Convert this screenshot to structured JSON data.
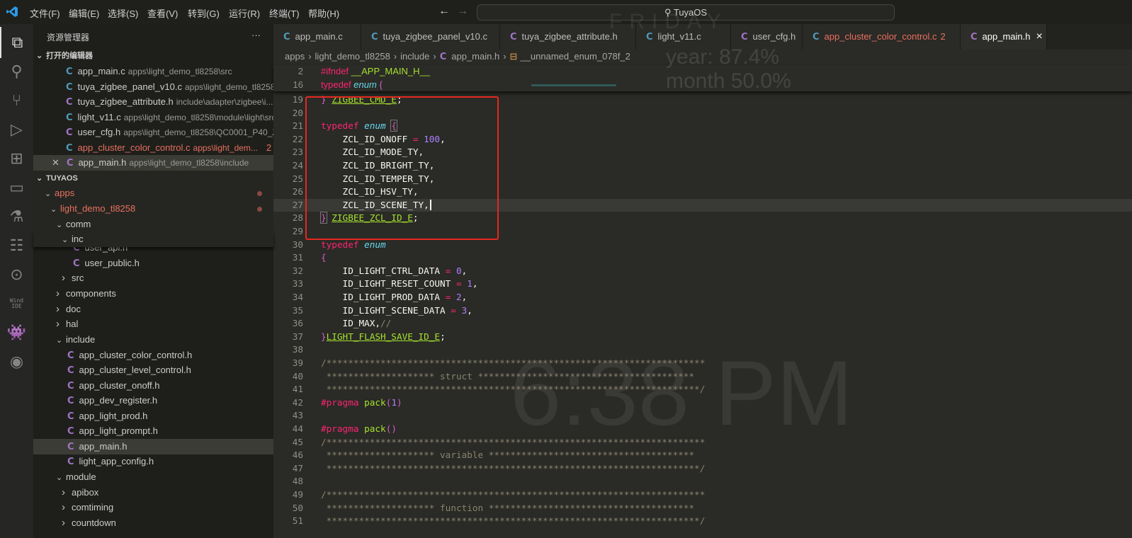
{
  "titlebar": {
    "menus": [
      "文件(F)",
      "编辑(E)",
      "选择(S)",
      "查看(V)",
      "转到(G)",
      "运行(R)",
      "终端(T)",
      "帮助(H)"
    ],
    "search": "TuyaOS",
    "back_icon": "arrow-left-icon",
    "forward_icon": "arrow-right-icon"
  },
  "activity_bar": [
    "explorer-icon",
    "search-icon",
    "source-control-icon",
    "run-debug-icon",
    "extensions-icon",
    "remote-explorer-icon",
    "testing-icon",
    "timeline-icon",
    "git-graph-icon",
    "wind-ide-icon",
    "platformio-icon",
    "espressif-icon"
  ],
  "wind_ide_label": "Wind IDE",
  "sidebar": {
    "title": "资源管理器",
    "more": "···",
    "open_editors_title": "打开的编辑器",
    "open_editors": [
      {
        "name": "app_main.c",
        "type": "c",
        "desc": "apps\\light_demo_tl8258\\src"
      },
      {
        "name": "tuya_zigbee_panel_v10.c",
        "type": "c",
        "desc": "apps\\light_demo_tl8258..."
      },
      {
        "name": "tuya_zigbee_attribute.h",
        "type": "h",
        "desc": "include\\adapter\\zigbee\\i..."
      },
      {
        "name": "light_v11.c",
        "type": "c",
        "desc": "apps\\light_demo_tl8258\\module\\light\\src"
      },
      {
        "name": "user_cfg.h",
        "type": "h",
        "desc": "apps\\light_demo_tl8258\\QC0001_P40_Z..."
      },
      {
        "name": "app_cluster_color_control.c",
        "type": "c",
        "desc": "apps\\light_dem...",
        "badge": "2",
        "error": true
      },
      {
        "name": "app_main.h",
        "type": "h",
        "desc": "apps\\light_demo_tl8258\\include",
        "active": true
      }
    ],
    "workspace_title": "TUYAOS",
    "tree": [
      {
        "label": "apps",
        "kind": "folder",
        "open": true,
        "depth": 0,
        "error": true
      },
      {
        "label": "light_demo_tl8258",
        "kind": "folder",
        "open": true,
        "depth": 1,
        "error": true
      },
      {
        "label": "comm",
        "kind": "folder",
        "open": true,
        "depth": 2
      },
      {
        "label": "inc",
        "kind": "folder",
        "open": true,
        "depth": 3
      },
      {
        "label": "user_api.h",
        "kind": "h",
        "depth": 4
      },
      {
        "label": "user_public.h",
        "kind": "h",
        "depth": 4
      },
      {
        "label": "src",
        "kind": "folder",
        "open": false,
        "depth": 3
      },
      {
        "label": "components",
        "kind": "folder",
        "open": false,
        "depth": 2
      },
      {
        "label": "doc",
        "kind": "folder",
        "open": false,
        "depth": 2
      },
      {
        "label": "hal",
        "kind": "folder",
        "open": false,
        "depth": 2
      },
      {
        "label": "include",
        "kind": "folder",
        "open": true,
        "depth": 2
      },
      {
        "label": "app_cluster_color_control.h",
        "kind": "h",
        "depth": 3
      },
      {
        "label": "app_cluster_level_control.h",
        "kind": "h",
        "depth": 3
      },
      {
        "label": "app_cluster_onoff.h",
        "kind": "h",
        "depth": 3
      },
      {
        "label": "app_dev_register.h",
        "kind": "h",
        "depth": 3
      },
      {
        "label": "app_light_prod.h",
        "kind": "h",
        "depth": 3
      },
      {
        "label": "app_light_prompt.h",
        "kind": "h",
        "depth": 3
      },
      {
        "label": "app_main.h",
        "kind": "h",
        "depth": 3,
        "selected": true
      },
      {
        "label": "light_app_config.h",
        "kind": "h",
        "depth": 3
      },
      {
        "label": "module",
        "kind": "folder",
        "open": true,
        "depth": 2
      },
      {
        "label": "apibox",
        "kind": "folder",
        "open": false,
        "depth": 3
      },
      {
        "label": "comtiming",
        "kind": "folder",
        "open": false,
        "depth": 3
      },
      {
        "label": "countdown",
        "kind": "folder",
        "open": false,
        "depth": 3
      }
    ]
  },
  "tabs": [
    {
      "name": "app_main.c",
      "type": "c"
    },
    {
      "name": "tuya_zigbee_panel_v10.c",
      "type": "c"
    },
    {
      "name": "tuya_zigbee_attribute.h",
      "type": "h"
    },
    {
      "name": "light_v11.c",
      "type": "c"
    },
    {
      "name": "user_cfg.h",
      "type": "h"
    },
    {
      "name": "app_cluster_color_control.c",
      "type": "c",
      "badge": "2",
      "error": true
    },
    {
      "name": "app_main.h",
      "type": "h",
      "active": true,
      "close": "×"
    }
  ],
  "breadcrumb": [
    "apps",
    "light_demo_tl8258",
    "include",
    "app_main.h",
    "__unnamed_enum_078f_2"
  ],
  "wallpaper": {
    "day": "FRIDAY",
    "year": "year: 87.4%",
    "month": "month 50.0%",
    "time": "6:38 PM"
  },
  "sticky_lines": [
    {
      "n": "2",
      "tokens": [
        [
          "#ifndef",
          "pp"
        ],
        [
          " "
        ],
        [
          "__APP_MAIN_H__",
          "fn"
        ]
      ]
    },
    {
      "n": "16",
      "tokens": [
        [
          "typedef",
          "kw"
        ],
        [
          " "
        ],
        [
          "enum",
          "ty"
        ],
        [
          " "
        ],
        [
          "{",
          "br"
        ]
      ]
    }
  ],
  "code_lines": [
    {
      "n": "19",
      "tokens": [
        [
          "}",
          "br"
        ],
        [
          " "
        ],
        [
          "ZIGBEE_CMD_E",
          "nm"
        ],
        [
          ";"
        ]
      ]
    },
    {
      "n": "20",
      "tokens": []
    },
    {
      "n": "21",
      "tokens": [
        [
          "typedef",
          "kw"
        ],
        [
          " "
        ],
        [
          "enum",
          "ty"
        ],
        [
          " "
        ],
        [
          "{",
          "br"
        ]
      ]
    },
    {
      "n": "22",
      "tokens": [
        [
          "    ZCL_ID_ONOFF "
        ],
        [
          "=",
          "op"
        ],
        [
          " "
        ],
        [
          "100",
          "num"
        ],
        [
          ","
        ]
      ]
    },
    {
      "n": "23",
      "tokens": [
        [
          "    ZCL_ID_MODE_TY,"
        ]
      ]
    },
    {
      "n": "24",
      "tokens": [
        [
          "    ZCL_ID_BRIGHT_TY,"
        ]
      ]
    },
    {
      "n": "25",
      "tokens": [
        [
          "    ZCL_ID_TEMPER_TY,"
        ]
      ]
    },
    {
      "n": "26",
      "tokens": [
        [
          "    ZCL_ID_HSV_TY,"
        ]
      ]
    },
    {
      "n": "27",
      "tokens": [
        [
          "    ZCL_ID_SCENE_TY,"
        ]
      ],
      "current": true
    },
    {
      "n": "28",
      "tokens": [
        [
          "}",
          "br"
        ],
        [
          " "
        ],
        [
          "ZIGBEE_ZCL_ID_E",
          "nm"
        ],
        [
          ";"
        ]
      ]
    },
    {
      "n": "29",
      "tokens": []
    },
    {
      "n": "30",
      "tokens": [
        [
          "typedef",
          "kw"
        ],
        [
          " "
        ],
        [
          "enum",
          "ty"
        ]
      ]
    },
    {
      "n": "31",
      "tokens": [
        [
          "{",
          "br"
        ]
      ]
    },
    {
      "n": "32",
      "tokens": [
        [
          "    ID_LIGHT_CTRL_DATA "
        ],
        [
          "=",
          "op"
        ],
        [
          " "
        ],
        [
          "0",
          "num"
        ],
        [
          ","
        ]
      ]
    },
    {
      "n": "33",
      "tokens": [
        [
          "    ID_LIGHT_RESET_COUNT "
        ],
        [
          "=",
          "op"
        ],
        [
          " "
        ],
        [
          "1",
          "num"
        ],
        [
          ","
        ]
      ]
    },
    {
      "n": "34",
      "tokens": [
        [
          "    ID_LIGHT_PROD_DATA "
        ],
        [
          "=",
          "op"
        ],
        [
          " "
        ],
        [
          "2",
          "num"
        ],
        [
          ","
        ]
      ]
    },
    {
      "n": "35",
      "tokens": [
        [
          "    ID_LIGHT_SCENE_DATA "
        ],
        [
          "=",
          "op"
        ],
        [
          " "
        ],
        [
          "3",
          "num"
        ],
        [
          ","
        ]
      ]
    },
    {
      "n": "36",
      "tokens": [
        [
          "    ID_MAX,"
        ],
        [
          "//",
          "cm"
        ]
      ]
    },
    {
      "n": "37",
      "tokens": [
        [
          "}",
          "br"
        ],
        [
          "LIGHT_FLASH_SAVE_ID_E",
          "nm"
        ],
        [
          ";"
        ]
      ]
    },
    {
      "n": "38",
      "tokens": []
    },
    {
      "n": "39",
      "tokens": [
        [
          "/**********************************************************************",
          "cm"
        ]
      ]
    },
    {
      "n": "40",
      "tokens": [
        [
          " ******************** struct ****************************************",
          "cm"
        ]
      ]
    },
    {
      "n": "41",
      "tokens": [
        [
          " *********************************************************************/",
          "cm"
        ]
      ]
    },
    {
      "n": "42",
      "tokens": [
        [
          "#pragma",
          "pp"
        ],
        [
          " "
        ],
        [
          "pack",
          "fn"
        ],
        [
          "(",
          "br"
        ],
        [
          "1",
          "num"
        ],
        [
          ")",
          "br"
        ]
      ]
    },
    {
      "n": "43",
      "tokens": []
    },
    {
      "n": "44",
      "tokens": [
        [
          "#pragma",
          "pp"
        ],
        [
          " "
        ],
        [
          "pack",
          "fn"
        ],
        [
          "()",
          "br"
        ]
      ]
    },
    {
      "n": "45",
      "tokens": [
        [
          "/**********************************************************************",
          "cm"
        ]
      ]
    },
    {
      "n": "46",
      "tokens": [
        [
          " ******************** variable **************************************",
          "cm"
        ]
      ]
    },
    {
      "n": "47",
      "tokens": [
        [
          " *********************************************************************/",
          "cm"
        ]
      ]
    },
    {
      "n": "48",
      "tokens": []
    },
    {
      "n": "49",
      "tokens": [
        [
          "/**********************************************************************",
          "cm"
        ]
      ]
    },
    {
      "n": "50",
      "tokens": [
        [
          " ******************** function **************************************",
          "cm"
        ]
      ]
    },
    {
      "n": "51",
      "tokens": [
        [
          " *********************************************************************/",
          "cm"
        ]
      ]
    }
  ],
  "colors": {
    "keyword": "#f92672",
    "type": "#66d9ef",
    "name": "#a6e22e",
    "number": "#ae81ff",
    "comment": "#88846f",
    "highlight_box": "#e5281f",
    "error": "#e8705e",
    "c_file": "#519aba",
    "h_file": "#a074c4"
  }
}
